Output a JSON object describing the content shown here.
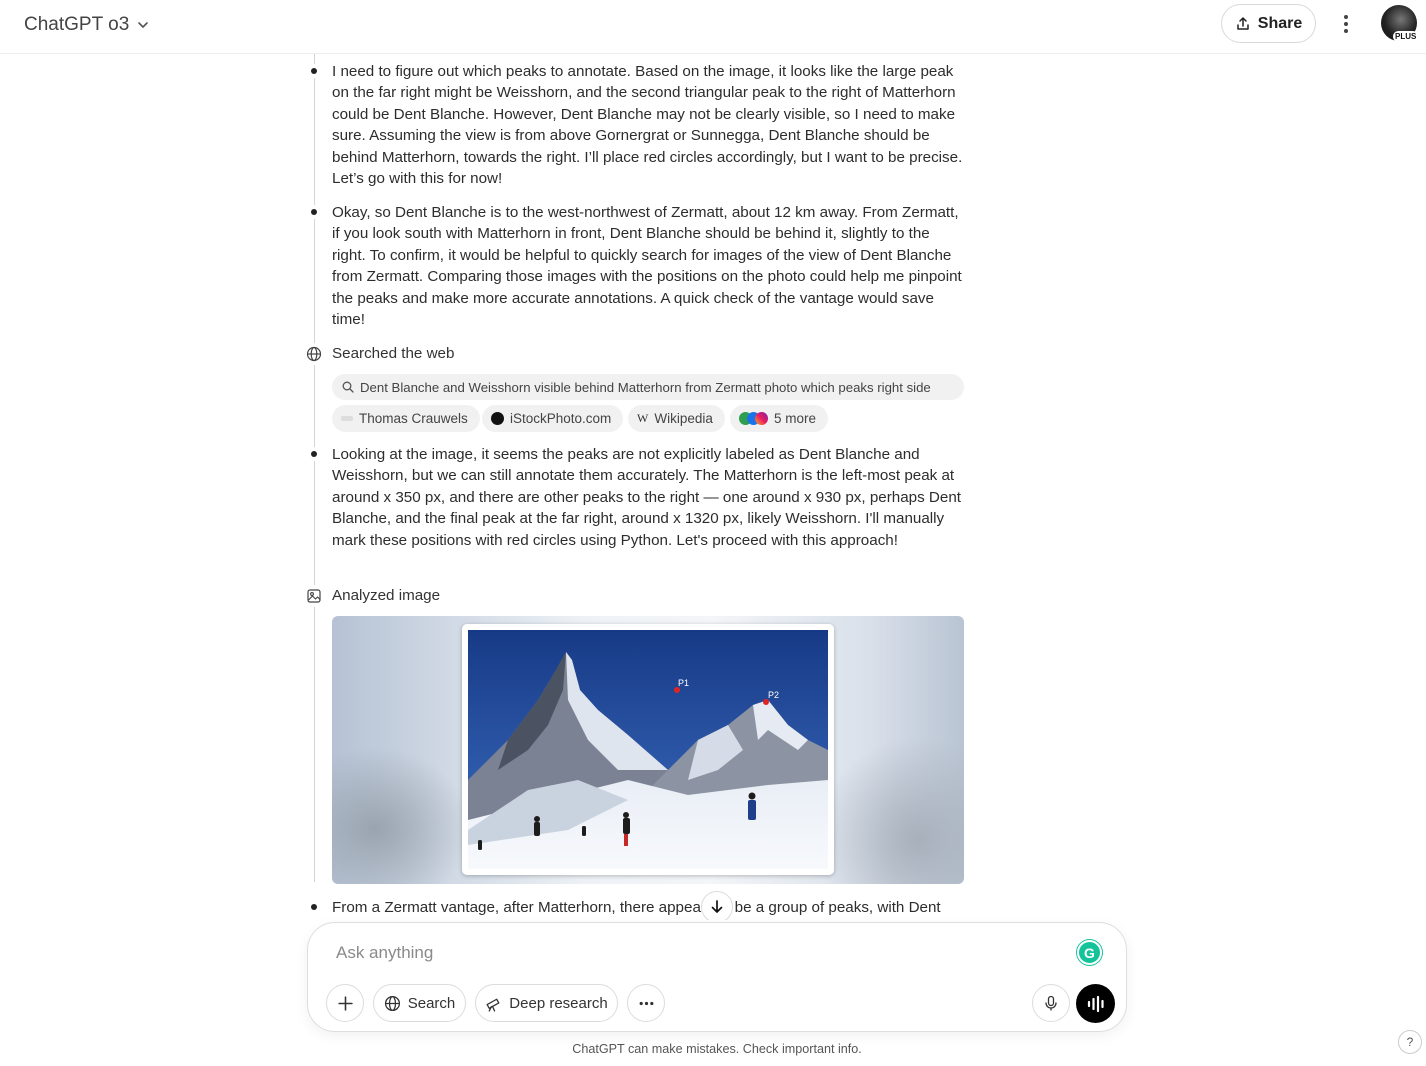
{
  "header": {
    "model_name": "ChatGPT o3",
    "share_label": "Share",
    "avatar_badge": "PLUS"
  },
  "thread": {
    "paragraphs": [
      "I need to figure out which peaks to annotate. Based on the image, it looks like the large peak on the far right might be Weisshorn, and the second triangular peak to the right of Matterhorn could be Dent Blanche. However, Dent Blanche may not be clearly visible, so I need to make sure. Assuming the view is from above Gornergrat or Sunnegga, Dent Blanche should be behind Matterhorn, towards the right. I’ll place red circles accordingly, but I want to be precise. Let’s go with this for now!",
      "Okay, so Dent Blanche is to the west-northwest of Zermatt, about 12 km away. From Zermatt, if you look south with Matterhorn in front, Dent Blanche should be behind it, slightly to the right. To confirm, it would be helpful to quickly search for images of the view of Dent Blanche from Zermatt. Comparing those images with the positions on the photo could help me pinpoint the peaks and make more accurate annotations. A quick check of the vantage would save time!",
      "Looking at the image, it seems the peaks are not explicitly labeled as Dent Blanche and Weisshorn, but we can still annotate them accurately. The Matterhorn is the left-most peak at around x 350 px, and there are other peaks to the right — one around x 930 px, perhaps Dent Blanche, and the final peak at the far right, around x 1320 px, likely Weisshorn. I'll manually mark these positions with red circles using Python. Let's proceed with this approach!",
      "From a Zermatt vantage, after Matterhorn, there appears to be a group of peaks, with Dent"
    ],
    "search_step": {
      "label": "Searched the web",
      "query": "Dent Blanche and Weisshorn visible behind Matterhorn from Zermatt photo which peaks right side",
      "sources": [
        "Thomas Crauwels",
        "iStockPhoto.com",
        "Wikipedia",
        "5 more"
      ]
    },
    "analyze_step": {
      "label": "Analyzed image",
      "markers": [
        "P1",
        "P2"
      ]
    }
  },
  "composer": {
    "placeholder": "Ask anything",
    "search_label": "Search",
    "deep_research_label": "Deep research"
  },
  "footer": {
    "disclaimer": "ChatGPT can make mistakes. Check important info.",
    "help": "?"
  },
  "colors": {
    "accent_green": "#15c39a",
    "marker_red": "#e02424",
    "sky_blue": "#1d3f8c"
  }
}
